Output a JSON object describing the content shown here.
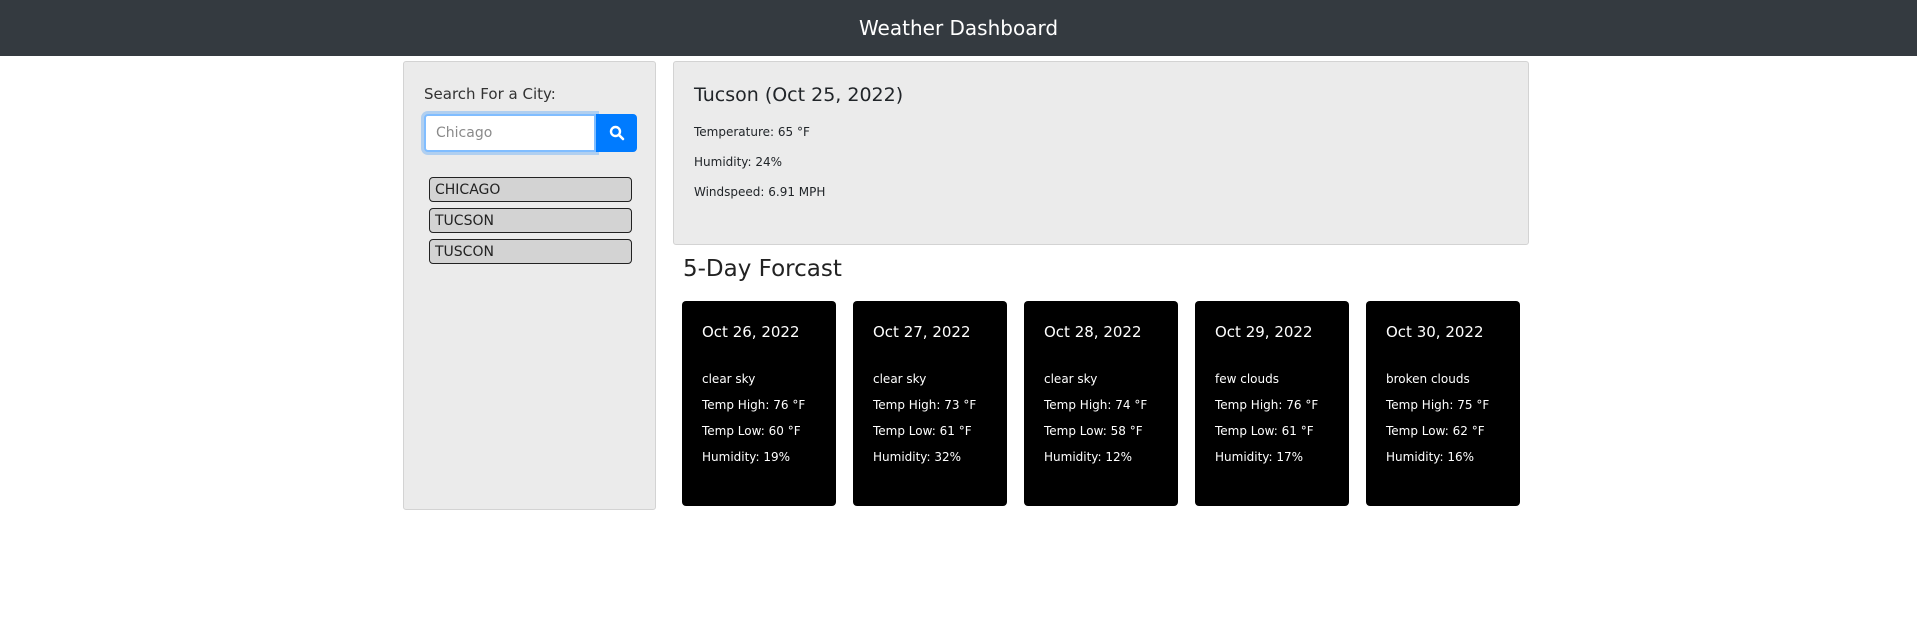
{
  "header": {
    "title": "Weather Dashboard"
  },
  "search": {
    "label": "Search For a City:",
    "placeholder": "Chicago",
    "button_icon": "search-icon"
  },
  "history": [
    "CHICAGO",
    "TUCSON",
    "TUSCON"
  ],
  "current": {
    "title": "Tucson (Oct 25, 2022)",
    "temperature": "Temperature: 65 °F",
    "humidity": "Humidity: 24%",
    "windspeed": "Windspeed: 6.91 MPH"
  },
  "forecast": {
    "heading": "5-Day Forcast",
    "days": [
      {
        "date": "Oct 26, 2022",
        "desc": "clear sky",
        "high": "Temp High: 76 °F",
        "low": "Temp Low: 60 °F",
        "humidity": "Humidity: 19%"
      },
      {
        "date": "Oct 27, 2022",
        "desc": "clear sky",
        "high": "Temp High: 73 °F",
        "low": "Temp Low: 61 °F",
        "humidity": "Humidity: 32%"
      },
      {
        "date": "Oct 28, 2022",
        "desc": "clear sky",
        "high": "Temp High: 74 °F",
        "low": "Temp Low: 58 °F",
        "humidity": "Humidity: 12%"
      },
      {
        "date": "Oct 29, 2022",
        "desc": "few clouds",
        "high": "Temp High: 76 °F",
        "low": "Temp Low: 61 °F",
        "humidity": "Humidity: 17%"
      },
      {
        "date": "Oct 30, 2022",
        "desc": "broken clouds",
        "high": "Temp High: 75 °F",
        "low": "Temp Low: 62 °F",
        "humidity": "Humidity: 16%"
      }
    ]
  },
  "colors": {
    "header_bg": "#343a40",
    "panel_bg": "#ebebeb",
    "accent": "#007bff",
    "card_bg": "#000000"
  }
}
